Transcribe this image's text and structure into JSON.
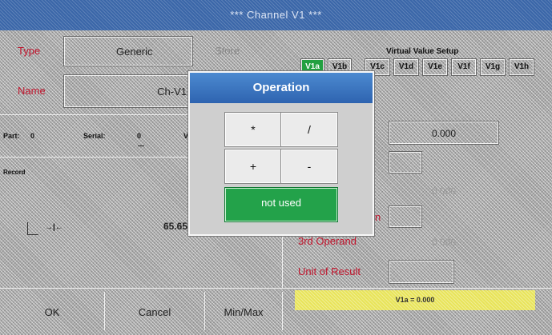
{
  "window": {
    "title": "*** Channel V1 ***"
  },
  "left": {
    "type_label": "Type",
    "type_value": "Generic",
    "type_side_button": "Store",
    "name_label": "Name",
    "name_value": "Ch-V1",
    "part_label": "Part:",
    "part_value": "0",
    "serial_label": "Serial:",
    "serial_value": "0",
    "serial_trailing": "V",
    "record_label": "Record",
    "record_left_ctrl": "→|←",
    "record_value": "65.65"
  },
  "right": {
    "setup_title": "Virtual Value Setup",
    "tabs": [
      "V1a",
      "V1b",
      "V1c",
      "V1d",
      "V1e",
      "V1f",
      "V1g",
      "V1h"
    ],
    "first_operand_value": "0.000",
    "second_operand_value": "0.000",
    "third_operand_label": "3rd Operand",
    "third_operand_value": "0.000",
    "unit_label": "Unit of Result",
    "operation_label_fragment": "n",
    "status": "V1a = 0.000"
  },
  "dialog": {
    "title": "Operation",
    "buttons": [
      "*",
      "/",
      "+",
      "-"
    ],
    "not_used_label": "not used"
  },
  "bottom": {
    "ok": "OK",
    "cancel": "Cancel",
    "minmax": "Min/Max"
  },
  "colors": {
    "accent_blue": "#3a66a8",
    "active_green": "#22a040",
    "label_red": "#c0142c",
    "status_yellow": "#e8e45a"
  }
}
